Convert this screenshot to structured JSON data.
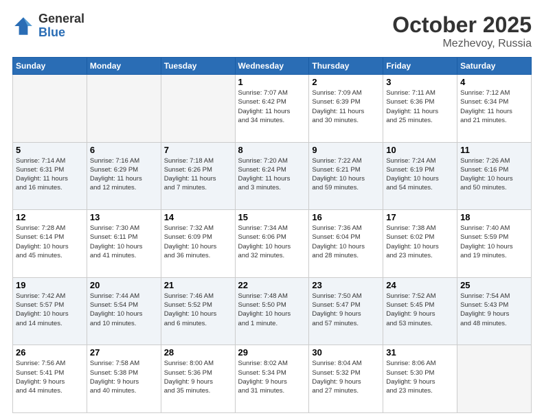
{
  "logo": {
    "general": "General",
    "blue": "Blue"
  },
  "header": {
    "month": "October 2025",
    "location": "Mezhevoy, Russia"
  },
  "weekdays": [
    "Sunday",
    "Monday",
    "Tuesday",
    "Wednesday",
    "Thursday",
    "Friday",
    "Saturday"
  ],
  "weeks": [
    [
      {
        "day": "",
        "info": ""
      },
      {
        "day": "",
        "info": ""
      },
      {
        "day": "",
        "info": ""
      },
      {
        "day": "1",
        "info": "Sunrise: 7:07 AM\nSunset: 6:42 PM\nDaylight: 11 hours\nand 34 minutes."
      },
      {
        "day": "2",
        "info": "Sunrise: 7:09 AM\nSunset: 6:39 PM\nDaylight: 11 hours\nand 30 minutes."
      },
      {
        "day": "3",
        "info": "Sunrise: 7:11 AM\nSunset: 6:36 PM\nDaylight: 11 hours\nand 25 minutes."
      },
      {
        "day": "4",
        "info": "Sunrise: 7:12 AM\nSunset: 6:34 PM\nDaylight: 11 hours\nand 21 minutes."
      }
    ],
    [
      {
        "day": "5",
        "info": "Sunrise: 7:14 AM\nSunset: 6:31 PM\nDaylight: 11 hours\nand 16 minutes."
      },
      {
        "day": "6",
        "info": "Sunrise: 7:16 AM\nSunset: 6:29 PM\nDaylight: 11 hours\nand 12 minutes."
      },
      {
        "day": "7",
        "info": "Sunrise: 7:18 AM\nSunset: 6:26 PM\nDaylight: 11 hours\nand 7 minutes."
      },
      {
        "day": "8",
        "info": "Sunrise: 7:20 AM\nSunset: 6:24 PM\nDaylight: 11 hours\nand 3 minutes."
      },
      {
        "day": "9",
        "info": "Sunrise: 7:22 AM\nSunset: 6:21 PM\nDaylight: 10 hours\nand 59 minutes."
      },
      {
        "day": "10",
        "info": "Sunrise: 7:24 AM\nSunset: 6:19 PM\nDaylight: 10 hours\nand 54 minutes."
      },
      {
        "day": "11",
        "info": "Sunrise: 7:26 AM\nSunset: 6:16 PM\nDaylight: 10 hours\nand 50 minutes."
      }
    ],
    [
      {
        "day": "12",
        "info": "Sunrise: 7:28 AM\nSunset: 6:14 PM\nDaylight: 10 hours\nand 45 minutes."
      },
      {
        "day": "13",
        "info": "Sunrise: 7:30 AM\nSunset: 6:11 PM\nDaylight: 10 hours\nand 41 minutes."
      },
      {
        "day": "14",
        "info": "Sunrise: 7:32 AM\nSunset: 6:09 PM\nDaylight: 10 hours\nand 36 minutes."
      },
      {
        "day": "15",
        "info": "Sunrise: 7:34 AM\nSunset: 6:06 PM\nDaylight: 10 hours\nand 32 minutes."
      },
      {
        "day": "16",
        "info": "Sunrise: 7:36 AM\nSunset: 6:04 PM\nDaylight: 10 hours\nand 28 minutes."
      },
      {
        "day": "17",
        "info": "Sunrise: 7:38 AM\nSunset: 6:02 PM\nDaylight: 10 hours\nand 23 minutes."
      },
      {
        "day": "18",
        "info": "Sunrise: 7:40 AM\nSunset: 5:59 PM\nDaylight: 10 hours\nand 19 minutes."
      }
    ],
    [
      {
        "day": "19",
        "info": "Sunrise: 7:42 AM\nSunset: 5:57 PM\nDaylight: 10 hours\nand 14 minutes."
      },
      {
        "day": "20",
        "info": "Sunrise: 7:44 AM\nSunset: 5:54 PM\nDaylight: 10 hours\nand 10 minutes."
      },
      {
        "day": "21",
        "info": "Sunrise: 7:46 AM\nSunset: 5:52 PM\nDaylight: 10 hours\nand 6 minutes."
      },
      {
        "day": "22",
        "info": "Sunrise: 7:48 AM\nSunset: 5:50 PM\nDaylight: 10 hours\nand 1 minute."
      },
      {
        "day": "23",
        "info": "Sunrise: 7:50 AM\nSunset: 5:47 PM\nDaylight: 9 hours\nand 57 minutes."
      },
      {
        "day": "24",
        "info": "Sunrise: 7:52 AM\nSunset: 5:45 PM\nDaylight: 9 hours\nand 53 minutes."
      },
      {
        "day": "25",
        "info": "Sunrise: 7:54 AM\nSunset: 5:43 PM\nDaylight: 9 hours\nand 48 minutes."
      }
    ],
    [
      {
        "day": "26",
        "info": "Sunrise: 7:56 AM\nSunset: 5:41 PM\nDaylight: 9 hours\nand 44 minutes."
      },
      {
        "day": "27",
        "info": "Sunrise: 7:58 AM\nSunset: 5:38 PM\nDaylight: 9 hours\nand 40 minutes."
      },
      {
        "day": "28",
        "info": "Sunrise: 8:00 AM\nSunset: 5:36 PM\nDaylight: 9 hours\nand 35 minutes."
      },
      {
        "day": "29",
        "info": "Sunrise: 8:02 AM\nSunset: 5:34 PM\nDaylight: 9 hours\nand 31 minutes."
      },
      {
        "day": "30",
        "info": "Sunrise: 8:04 AM\nSunset: 5:32 PM\nDaylight: 9 hours\nand 27 minutes."
      },
      {
        "day": "31",
        "info": "Sunrise: 8:06 AM\nSunset: 5:30 PM\nDaylight: 9 hours\nand 23 minutes."
      },
      {
        "day": "",
        "info": ""
      }
    ]
  ]
}
